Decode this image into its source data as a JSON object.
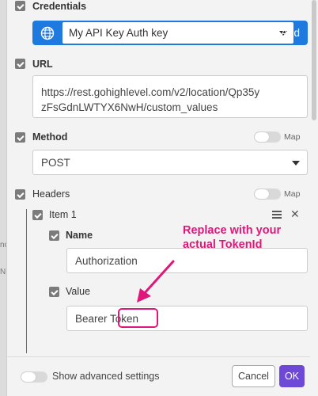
{
  "colors": {
    "accent": "#1f7ae0",
    "ok_button": "#6e49d8",
    "annotation": "#e0177a"
  },
  "background_fragments": [
    "no",
    "N"
  ],
  "credentials": {
    "label": "Credentials",
    "connection_value": "My API Key Auth key",
    "add_label": "Add",
    "icon": "globe-icon"
  },
  "url": {
    "label": "URL",
    "line1": "https://rest.gohighlevel.com/v2/location/Qp35y",
    "line2": "zFsGdnLWTYX6NwH/custom_values"
  },
  "method": {
    "label": "Method",
    "map_label": "Map",
    "value": "POST"
  },
  "headers": {
    "label": "Headers",
    "map_label": "Map",
    "item": {
      "label": "Item 1",
      "name_label": "Name",
      "name_value": "Authorization",
      "value_label": "Value",
      "value_prefix": "Bearer ",
      "value_highlight": "Token"
    }
  },
  "annotation": {
    "line1": "Replace with your",
    "line2": "actual TokenId"
  },
  "footer": {
    "advanced_label": "Show advanced settings",
    "cancel_label": "Cancel",
    "ok_label": "OK"
  }
}
